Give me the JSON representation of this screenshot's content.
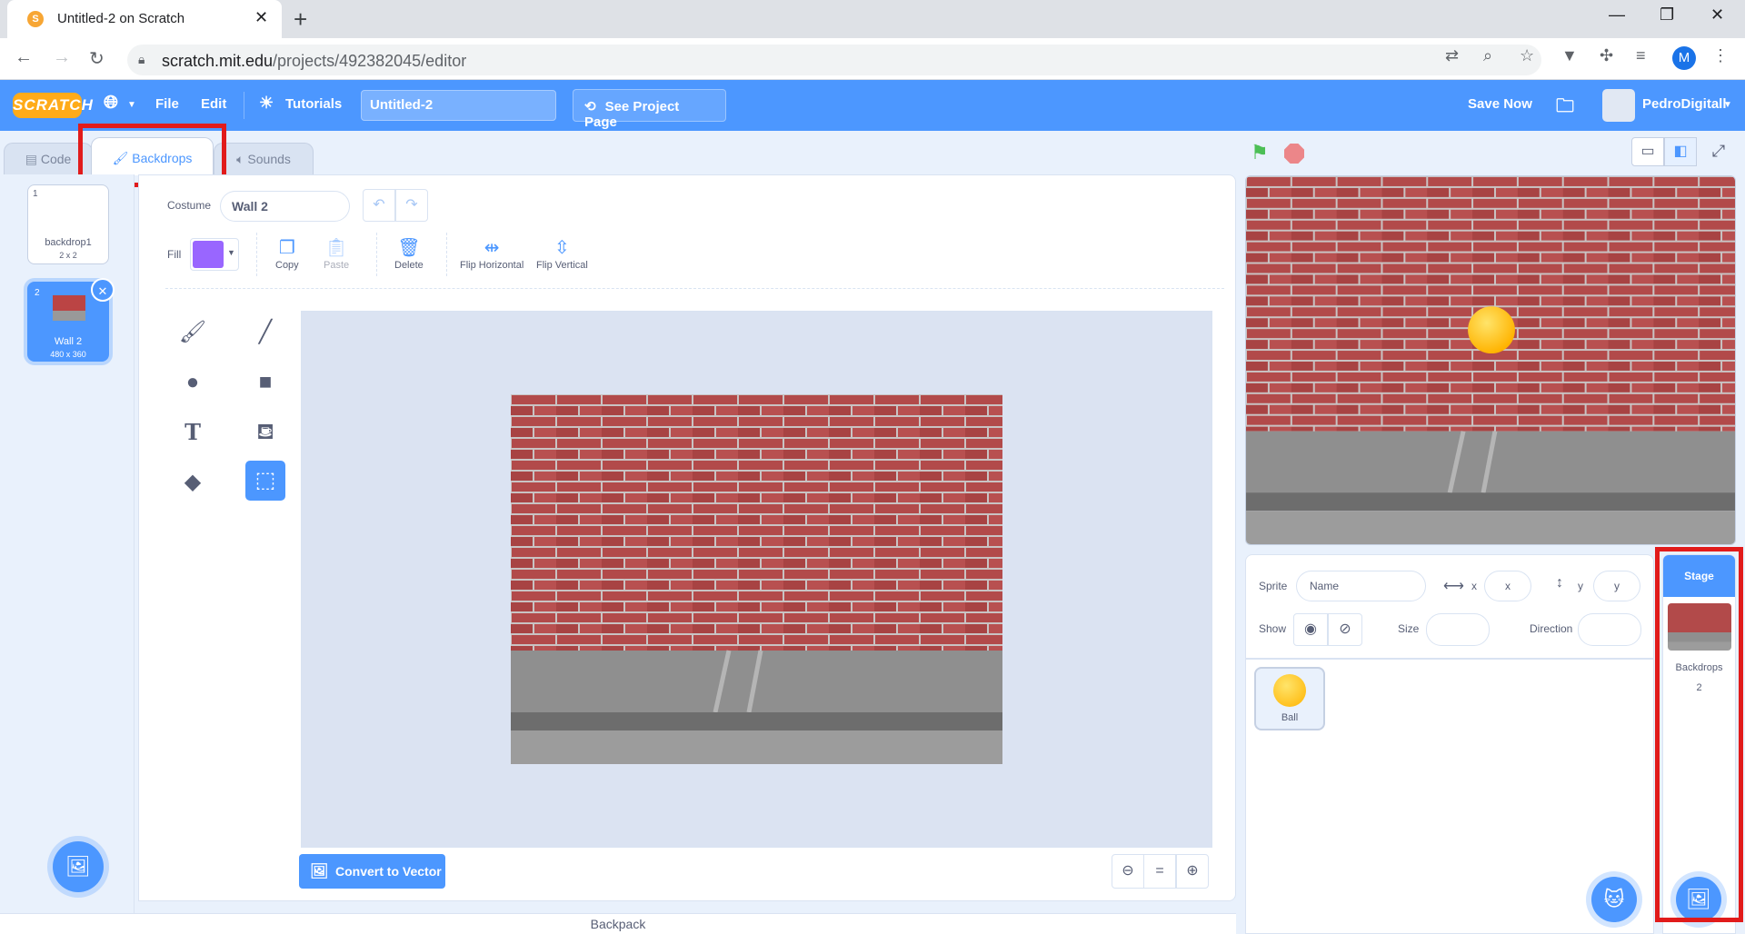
{
  "browser": {
    "tab_title": "Untitled-2 on Scratch",
    "url_host": "scratch.mit.edu",
    "url_path": "/projects/492382045/editor",
    "profile_initial": "M"
  },
  "menubar": {
    "logo": "SCRATCH",
    "file": "File",
    "edit": "Edit",
    "tutorials": "Tutorials",
    "project_title": "Untitled-2",
    "see_project_page": "See Project Page",
    "save_now": "Save Now",
    "username": "PedroDigitall"
  },
  "editor_tabs": {
    "code": "Code",
    "backdrops": "Backdrops",
    "sounds": "Sounds"
  },
  "costumes": [
    {
      "num": "1",
      "name": "backdrop1",
      "size": "2 x 2"
    },
    {
      "num": "2",
      "name": "Wall 2",
      "size": "480 x 360"
    }
  ],
  "paint": {
    "costume_label": "Costume",
    "costume_name": "Wall 2",
    "fill_label": "Fill",
    "fill_color": "#9966ff",
    "copy": "Copy",
    "paste": "Paste",
    "delete": "Delete",
    "flip_h": "Flip Horizontal",
    "flip_v": "Flip Vertical",
    "convert": "Convert to Vector",
    "zoom_reset": "="
  },
  "backpack": "Backpack",
  "sprite_info": {
    "sprite_label": "Sprite",
    "name_placeholder": "Name",
    "x_label": "x",
    "x_placeholder": "x",
    "y_label": "y",
    "y_placeholder": "y",
    "show_label": "Show",
    "size_label": "Size",
    "direction_label": "Direction"
  },
  "sprites": [
    {
      "name": "Ball"
    }
  ],
  "stage_panel": {
    "header": "Stage",
    "backdrops_label": "Backdrops",
    "backdrops_count": "2"
  },
  "colors": {
    "scratch_blue": "#4c97ff",
    "highlight_red": "#e11b1b",
    "ball": "#ffc000"
  }
}
